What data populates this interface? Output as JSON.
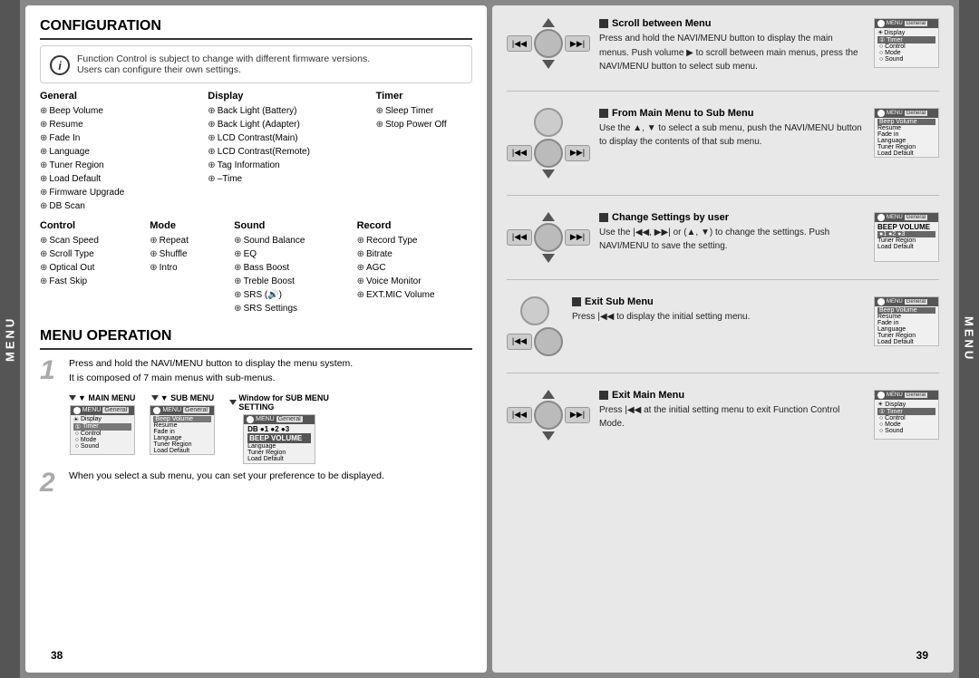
{
  "leftSideTab": "MENU",
  "rightSideTab": "MENU",
  "pageNumLeft": "38",
  "pageNumRight": "39",
  "leftPanel": {
    "configTitle": "CONFIGURATION",
    "infoText1": "Function Control is subject to change with different firmware versions.",
    "infoText2": "Users can configure their own settings.",
    "generalCol": {
      "header": "General",
      "items": [
        "Beep Volume",
        "Resume",
        "Fade In",
        "Language",
        "Tuner Region",
        "Load Default",
        "Firmware Upgrade",
        "DB  Scan"
      ]
    },
    "displayCol": {
      "header": "Display",
      "items": [
        "Back Light (Battery)",
        "Back Light (Adapter)",
        "LCD Contrast(Main)",
        "LCD Contrast(Remote)",
        "Tag Information",
        "–Time"
      ]
    },
    "timerCol": {
      "header": "Timer",
      "items": [
        "Sleep Timer",
        "Stop Power Off"
      ]
    },
    "controlCol": {
      "header": "Control",
      "items": [
        "Scan Speed",
        "Scroll Type",
        "Optical Out",
        "Fast Skip"
      ]
    },
    "modeCol": {
      "header": "Mode",
      "items": [
        "Repeat",
        "Shuffle",
        "Intro"
      ]
    },
    "soundCol": {
      "header": "Sound",
      "items": [
        "Sound Balance",
        "EQ",
        "Bass Boost",
        "Treble Boost",
        "SRS (🔊)",
        "SRS Settings"
      ]
    },
    "recordCol": {
      "header": "Record",
      "items": [
        "Record Type",
        "Bitrate",
        "AGC",
        "Voice Monitor",
        "EXT.MIC Volume"
      ]
    },
    "menuOpTitle": "MENU OPERATION",
    "step1Text": "Press and hold the NAVI/MENU button to display the menu system.\nIt is composed of 7 main menus with sub-menus.",
    "step1Num": "1",
    "mainMenuLabel": "▼ MAIN MENU",
    "subMenuLabel": "▼ SUB MENU",
    "subMenuSettingLabel": "▼ Window for SUB MENU\n  SETTING",
    "step2Num": "2",
    "step2Text": "When you select a sub menu, you can set your preference to be displayed."
  },
  "rightPanel": {
    "scrollBetweenMenu": {
      "heading": "Scroll between Menu",
      "body": "Press and hold the NAVI/MENU button to display the main menus. Push volume ▶ to scroll between main menus, press the NAVI/MENU button to select sub menu."
    },
    "fromMainToSub": {
      "heading": "From Main Menu to Sub Menu",
      "body": "Use the ▲, ▼ to select a sub menu, push the NAVI/MENU button to display the contents of that sub menu."
    },
    "changeSettings": {
      "heading": "Change Settings by user",
      "body": "Use the |◀◀, ▶▶| or (▲, ▼) to change the settings. Push NAVI/MENU to save the setting."
    },
    "exitSubMenu": {
      "heading": "Exit Sub Menu",
      "body": "Press |◀◀ to display the initial setting menu."
    },
    "exitMainMenu": {
      "heading": "Exit Main Menu",
      "body": "Press |◀◀ at the initial setting menu to exit Function Control Mode."
    }
  },
  "menuImages": {
    "mainMenuItems": [
      "General",
      "Display",
      "Timer",
      "Control",
      "Mode",
      "Sound"
    ],
    "subMenuItems": [
      "Beep Volume",
      "Resume",
      "Fade in",
      "Language",
      "Tuner Region",
      "Load Default"
    ],
    "windowItems": [
      "DB ●1 ●2 ●3",
      "BEEP VOLUME"
    ]
  }
}
